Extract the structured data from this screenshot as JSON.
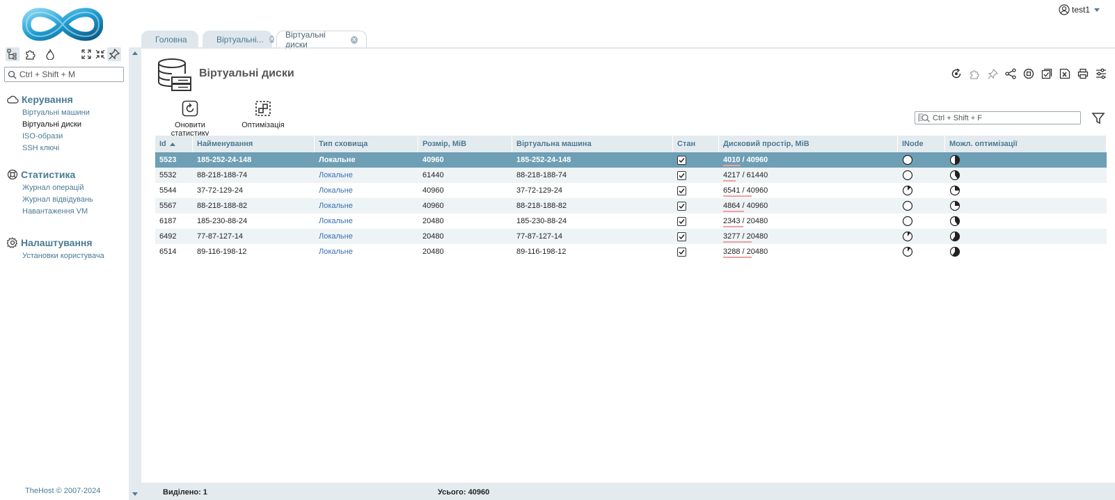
{
  "user": {
    "name": "test1"
  },
  "sidebar": {
    "search_placeholder": "Ctrl + Shift + M",
    "groups": [
      {
        "title": "Керування",
        "icon": "cloud-icon",
        "items": [
          "Віртуальні машини",
          "Віртуальні диски",
          "ISO-образи",
          "SSH ключі"
        ]
      },
      {
        "title": "Статистика",
        "icon": "lifebuoy-icon",
        "items": [
          "Журнал операцій",
          "Журнал відвідувань",
          "Навантаження VM"
        ]
      },
      {
        "title": "Налаштування",
        "icon": "gear-icon",
        "items": [
          "Установки користувача"
        ]
      }
    ],
    "copyright": "TheHost © 2007-2024"
  },
  "tabs": [
    {
      "label": "Головна",
      "closable": false
    },
    {
      "label": "Віртуальні...",
      "closable": true
    },
    {
      "label": "Віртуальні диски",
      "closable": true,
      "active": true
    }
  ],
  "page": {
    "title": "Віртуальні диски",
    "actions": [
      "Оновити статистику",
      "Оптимізація"
    ],
    "filter_placeholder": "Ctrl + Shift + F"
  },
  "grid": {
    "columns": [
      "Id",
      "Найменування",
      "Тип сховища",
      "Розмір, MiB",
      "Віртуальна машина",
      "Стан",
      "Дисковий простір, MiB",
      "INode",
      "Можл. оптимізації"
    ],
    "rows": [
      {
        "id": "5523",
        "name": "185-252-24-148",
        "storage": "Локальне",
        "size": "40960",
        "vm": "185-252-24-148",
        "used": "4010",
        "total": "40960",
        "used_ratio": 0.098,
        "inode": 0.0,
        "opt": 0.5,
        "selected": true
      },
      {
        "id": "5532",
        "name": "88-218-188-74",
        "storage": "Локальне",
        "size": "61440",
        "vm": "88-218-188-74",
        "used": "4217",
        "total": "61440",
        "used_ratio": 0.069,
        "inode": 0.0,
        "opt": 0.4
      },
      {
        "id": "5544",
        "name": "37-72-129-24",
        "storage": "Локальне",
        "size": "40960",
        "vm": "37-72-129-24",
        "used": "6541",
        "total": "40960",
        "used_ratio": 0.16,
        "inode": 0.12,
        "opt": 0.25
      },
      {
        "id": "5567",
        "name": "88-218-188-82",
        "storage": "Локальне",
        "size": "40960",
        "vm": "88-218-188-82",
        "used": "4864",
        "total": "40960",
        "used_ratio": 0.119,
        "inode": 0.0,
        "opt": 0.25
      },
      {
        "id": "6187",
        "name": "185-230-88-24",
        "storage": "Локальне",
        "size": "20480",
        "vm": "185-230-88-24",
        "used": "2343",
        "total": "20480",
        "used_ratio": 0.114,
        "inode": 0.0,
        "opt": 0.4
      },
      {
        "id": "6492",
        "name": "77-87-127-14",
        "storage": "Локальне",
        "size": "20480",
        "vm": "77-87-127-14",
        "used": "3277",
        "total": "20480",
        "used_ratio": 0.16,
        "inode": 0.1,
        "opt": 0.6
      },
      {
        "id": "6514",
        "name": "89-116-198-12",
        "storage": "Локальне",
        "size": "20480",
        "vm": "89-116-198-12",
        "used": "3288",
        "total": "20480",
        "used_ratio": 0.16,
        "inode": 0.1,
        "opt": 0.6
      }
    ]
  },
  "footer": {
    "selected": "Виділено: 1",
    "total": "Усього: 40960"
  },
  "colors": {
    "accent": "#4a7a95",
    "selected_row": "#6e9fb5",
    "usage_bar": "#f0a0a0"
  }
}
